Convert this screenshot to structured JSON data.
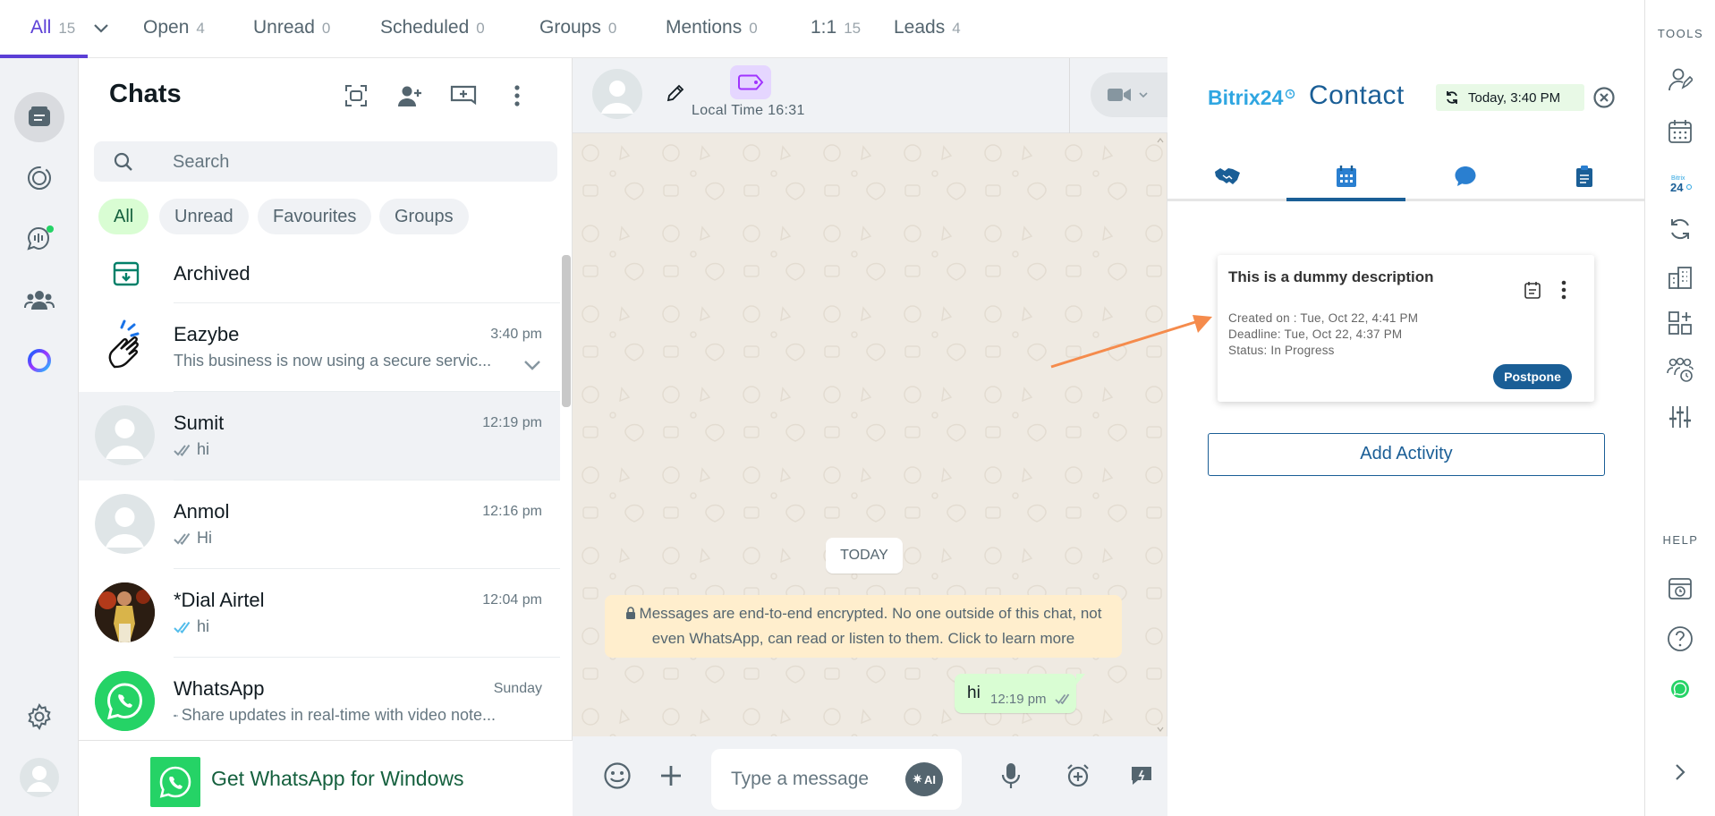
{
  "filter_tabs": [
    {
      "label": "All",
      "count": "15"
    },
    {
      "label": "Open",
      "count": "4"
    },
    {
      "label": "Unread",
      "count": "0"
    },
    {
      "label": "Scheduled",
      "count": "0"
    },
    {
      "label": "Groups",
      "count": "0"
    },
    {
      "label": "Mentions",
      "count": "0"
    },
    {
      "label": "1:1",
      "count": "15"
    },
    {
      "label": "Leads",
      "count": "4"
    }
  ],
  "chats_panel": {
    "title": "Chats",
    "search_placeholder": "Search",
    "chips": [
      "All",
      "Unread",
      "Favourites",
      "Groups"
    ],
    "archived_label": "Archived",
    "rows": [
      {
        "name": "Eazybe",
        "time": "3:40 pm",
        "preview": "This business is now using a secure servic..."
      },
      {
        "name": "Sumit",
        "time": "12:19 pm",
        "preview": "hi"
      },
      {
        "name": "Anmol",
        "time": "12:16 pm",
        "preview": "Hi"
      },
      {
        "name": "*Dial Airtel",
        "time": "12:04 pm",
        "preview": "hi"
      },
      {
        "name": "WhatsApp",
        "time": "Sunday",
        "preview": "Share updates in real-time with video note..."
      }
    ],
    "get_whatsapp_label": "Get WhatsApp for Windows"
  },
  "conversation": {
    "local_time": "Local Time 16:31",
    "day_badge": "TODAY",
    "encryption_notice": "Messages are end-to-end encrypted. No one outside of this chat, not even WhatsApp, can read or listen to them. Click to learn more",
    "message_text": "hi",
    "message_time": "12:19 pm",
    "composer_placeholder": "Type a message",
    "ai_label": "AI"
  },
  "contact_panel": {
    "logo_text": "Bitrix24",
    "title": "Contact",
    "sync_label": "Today, 3:40 PM",
    "activity": {
      "description": "This is a dummy description",
      "created": "Created on : Tue, Oct 22, 4:41 PM",
      "deadline": "Deadline: Tue, Oct 22, 4:37 PM",
      "status": "Status: In Progress",
      "postpone_label": "Postpone"
    },
    "add_activity_label": "Add Activity"
  },
  "tools_rail": {
    "tools_label": "TOOLS",
    "help_label": "HELP"
  },
  "colors": {
    "accent": "#5b3fd6",
    "whatsapp_green": "#25d366",
    "bitrix_blue": "#1a5e96"
  }
}
